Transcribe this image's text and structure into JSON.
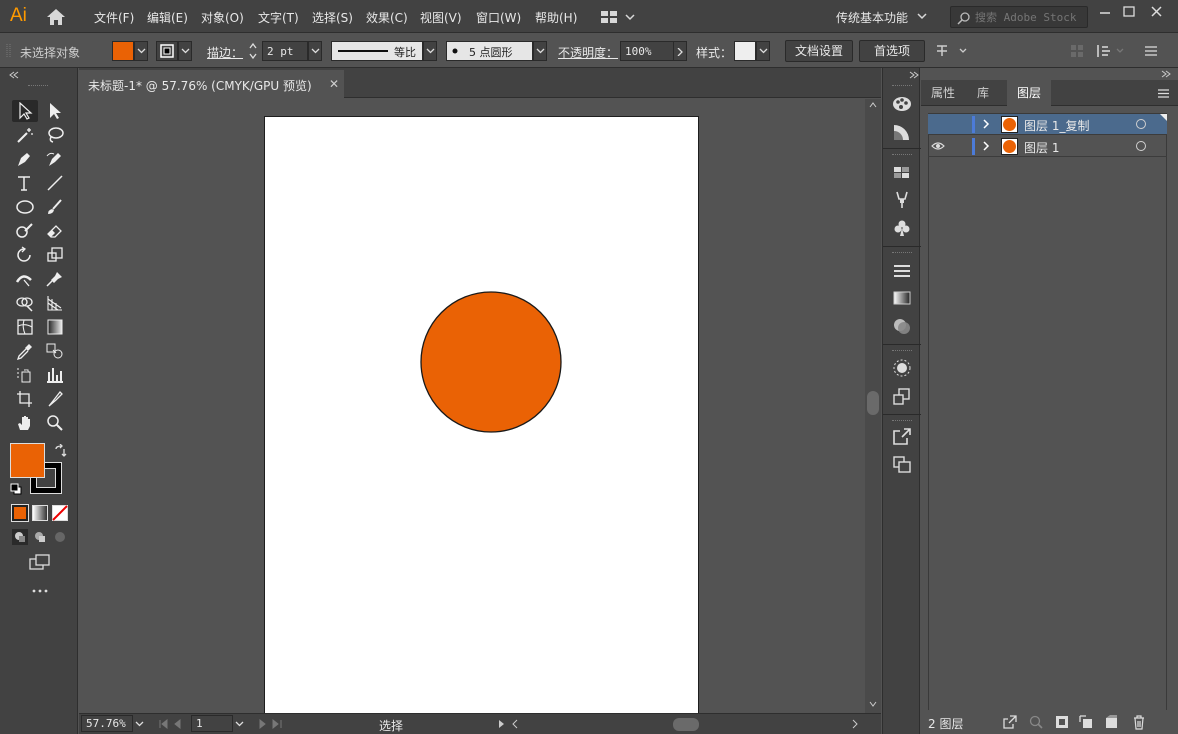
{
  "app": {
    "logo": "Ai",
    "menus": [
      "文件(F)",
      "编辑(E)",
      "对象(O)",
      "文字(T)",
      "选择(S)",
      "效果(C)",
      "视图(V)",
      "窗口(W)",
      "帮助(H)"
    ],
    "workspace": "传统基本功能",
    "stock_search_placeholder": "搜索 Adobe Stock"
  },
  "control_bar": {
    "selection_status": "未选择对象",
    "fill_color": "#ea6205",
    "stroke_label": "描边：",
    "stroke_weight": "2 pt",
    "stroke_profile": "等比",
    "brush": "5 点圆形",
    "opacity_label": "不透明度：",
    "opacity": "100%",
    "style_label": "样式：",
    "doc_setup_button": "文档设置",
    "preferences_button": "首选项"
  },
  "document": {
    "tab_title": "未标题-1* @ 57.76% (CMYK/GPU 预览)",
    "close": "✕",
    "circle_fill": "#ea6205",
    "circle_stroke": "#1a1a1a"
  },
  "status_bar": {
    "zoom": "57.76%",
    "artboard_number": "1",
    "tool_status": "选择"
  },
  "layers_panel": {
    "tabs": [
      "属性",
      "库",
      "图层"
    ],
    "active_tab": "图层",
    "layers": [
      {
        "name": "图层 1_复制",
        "selected": true,
        "visible": false
      },
      {
        "name": "图层 1",
        "selected": false,
        "visible": true
      }
    ],
    "layer_count": "2 图层"
  },
  "colors": {
    "accent_orange": "#ea6205",
    "layer_color": "#4c7bd8",
    "selection_bg": "#4b6a8d"
  }
}
